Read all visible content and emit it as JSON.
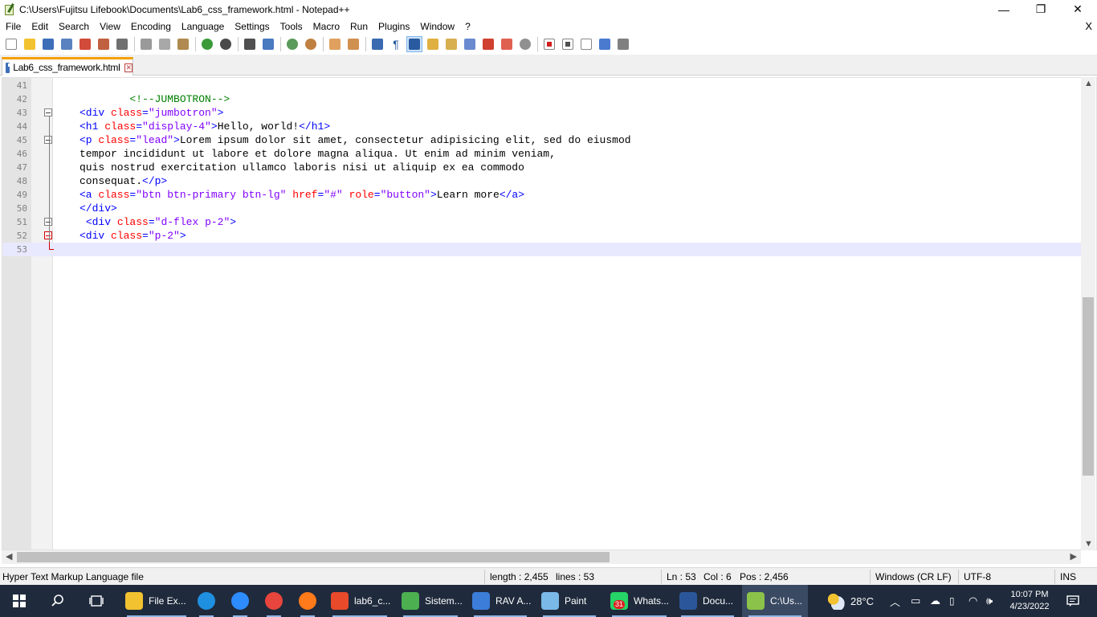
{
  "window": {
    "title": "C:\\Users\\Fujitsu Lifebook\\Documents\\Lab6_css_framework.html - Notepad++",
    "minimize": "—",
    "maximize": "❐",
    "close": "✕"
  },
  "menu": {
    "items": [
      "File",
      "Edit",
      "Search",
      "View",
      "Encoding",
      "Language",
      "Settings",
      "Tools",
      "Macro",
      "Run",
      "Plugins",
      "Window",
      "?"
    ],
    "close": "X"
  },
  "tab": {
    "label": "Lab6_css_framework.html",
    "close": "✕"
  },
  "editor": {
    "lines": [
      {
        "num": "41",
        "tokens": []
      },
      {
        "num": "42",
        "tokens": [
          {
            "t": "cmt",
            "v": "        <!--JUMBOTRON-->"
          }
        ]
      },
      {
        "num": "43",
        "tokens": [
          {
            "t": "tag",
            "v": "<div "
          },
          {
            "t": "attr",
            "v": "class"
          },
          {
            "t": "tag",
            "v": "="
          },
          {
            "t": "val",
            "v": "\"jumbotron\""
          },
          {
            "t": "tag",
            "v": ">"
          }
        ]
      },
      {
        "num": "44",
        "tokens": [
          {
            "t": "tag",
            "v": "<h1 "
          },
          {
            "t": "attr",
            "v": "class"
          },
          {
            "t": "tag",
            "v": "="
          },
          {
            "t": "val",
            "v": "\"display-4\""
          },
          {
            "t": "tag",
            "v": ">"
          },
          {
            "t": "txt",
            "v": "Hello, world!"
          },
          {
            "t": "tag",
            "v": "</h1>"
          }
        ]
      },
      {
        "num": "45",
        "tokens": [
          {
            "t": "tag",
            "v": "<p "
          },
          {
            "t": "attr",
            "v": "class"
          },
          {
            "t": "tag",
            "v": "="
          },
          {
            "t": "val",
            "v": "\"lead\""
          },
          {
            "t": "tag",
            "v": ">"
          },
          {
            "t": "txt",
            "v": "Lorem ipsum dolor sit amet, consectetur adipisicing elit, sed do eiusmod"
          }
        ]
      },
      {
        "num": "46",
        "tokens": [
          {
            "t": "txt",
            "v": "tempor incididunt ut labore et dolore magna aliqua. Ut enim ad minim veniam,"
          }
        ]
      },
      {
        "num": "47",
        "tokens": [
          {
            "t": "txt",
            "v": "quis nostrud exercitation ullamco laboris nisi ut aliquip ex ea commodo"
          }
        ]
      },
      {
        "num": "48",
        "tokens": [
          {
            "t": "txt",
            "v": "consequat."
          },
          {
            "t": "tag",
            "v": "</p>"
          }
        ]
      },
      {
        "num": "49",
        "tokens": [
          {
            "t": "tag",
            "v": "<a "
          },
          {
            "t": "attr",
            "v": "class"
          },
          {
            "t": "tag",
            "v": "="
          },
          {
            "t": "val",
            "v": "\"btn btn-primary btn-lg\""
          },
          {
            "t": "txt",
            "v": " "
          },
          {
            "t": "attr",
            "v": "href"
          },
          {
            "t": "tag",
            "v": "="
          },
          {
            "t": "val",
            "v": "\"#\""
          },
          {
            "t": "txt",
            "v": " "
          },
          {
            "t": "attr",
            "v": "role"
          },
          {
            "t": "tag",
            "v": "="
          },
          {
            "t": "val",
            "v": "\"button\""
          },
          {
            "t": "tag",
            "v": ">"
          },
          {
            "t": "txt",
            "v": "Learn more"
          },
          {
            "t": "tag",
            "v": "</a>"
          }
        ]
      },
      {
        "num": "50",
        "tokens": [
          {
            "t": "tag",
            "v": "</div>"
          }
        ]
      },
      {
        "num": "51",
        "tokens": [
          {
            "t": "txt",
            "v": " "
          },
          {
            "t": "tag",
            "v": "<div "
          },
          {
            "t": "attr",
            "v": "class"
          },
          {
            "t": "tag",
            "v": "="
          },
          {
            "t": "val",
            "v": "\"d-flex p-2\""
          },
          {
            "t": "tag",
            "v": ">"
          }
        ]
      },
      {
        "num": "52",
        "tokens": [
          {
            "t": "tag",
            "v": "<div "
          },
          {
            "t": "attr",
            "v": "class"
          },
          {
            "t": "tag",
            "v": "="
          },
          {
            "t": "val",
            "v": "\"p-2\""
          },
          {
            "t": "tag",
            "v": ">"
          }
        ]
      },
      {
        "num": "53",
        "tokens": []
      }
    ]
  },
  "status": {
    "filetype": "Hyper Text Markup Language file",
    "length": "length : 2,455",
    "lines": "lines : 53",
    "ln": "Ln : 53",
    "col": "Col : 6",
    "pos": "Pos : 2,456",
    "eol": "Windows (CR LF)",
    "encoding": "UTF-8",
    "mode": "INS"
  },
  "taskbar": {
    "apps": [
      {
        "label": "File Ex...",
        "color": "#f2c230"
      },
      {
        "label": "",
        "color": "#1f8fe0"
      },
      {
        "label": "",
        "color": "#2d8cff"
      },
      {
        "label": "",
        "color": "#e8453c"
      },
      {
        "label": "",
        "color": "#ff7a1a"
      },
      {
        "label": "lab6_c...",
        "color": "#e84a2a"
      },
      {
        "label": "Sistem...",
        "color": "#4caf50"
      },
      {
        "label": "RAV A...",
        "color": "#3c7dd9"
      },
      {
        "label": "Paint",
        "color": "#7ab8e8"
      },
      {
        "label": "Whats...",
        "color": "#25d366",
        "badge": "31"
      },
      {
        "label": "Docu...",
        "color": "#2b579a"
      },
      {
        "label": "C:\\Us...",
        "color": "#8bc34a"
      }
    ],
    "weather": "28°C",
    "time": "10:07 PM",
    "date": "4/23/2022"
  }
}
